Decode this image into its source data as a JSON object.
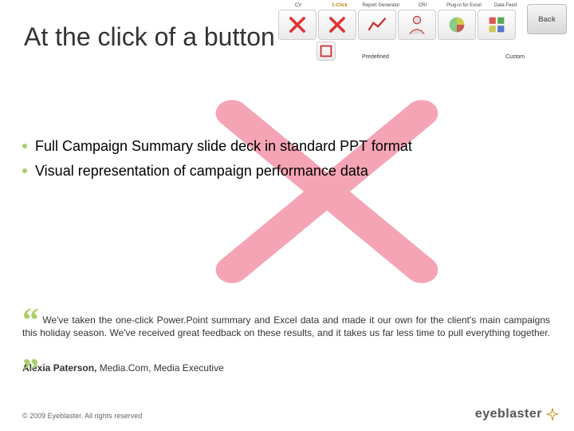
{
  "title": "At the click of a button",
  "categories": [
    {
      "label": "CV",
      "active": false
    },
    {
      "label": "1-Click",
      "active": true
    },
    {
      "label": "Report Generator",
      "active": false
    },
    {
      "label": "CRI",
      "active": false
    },
    {
      "label": "Plug-in for Excel",
      "active": false
    },
    {
      "label": "Data Feed",
      "active": false
    }
  ],
  "back_label": "Back",
  "subleft": "Predefined",
  "subright": "Custom",
  "bullets": [
    "Full Campaign Summary slide deck in standard PPT format",
    "Visual representation of campaign performance data"
  ],
  "quote": "We've taken the one-click Power.Point summary and Excel data and made it our own for the client's main campaigns this holiday season. We've received great feedback on these results, and it takes us far less time to pull everything together.",
  "attribution_name": "Alexia Paterson,",
  "attribution_rest": " Media.Com, Media Executive",
  "footer": "© 2009 Eyeblaster. All rights reserved",
  "brand": "eyeblaster"
}
